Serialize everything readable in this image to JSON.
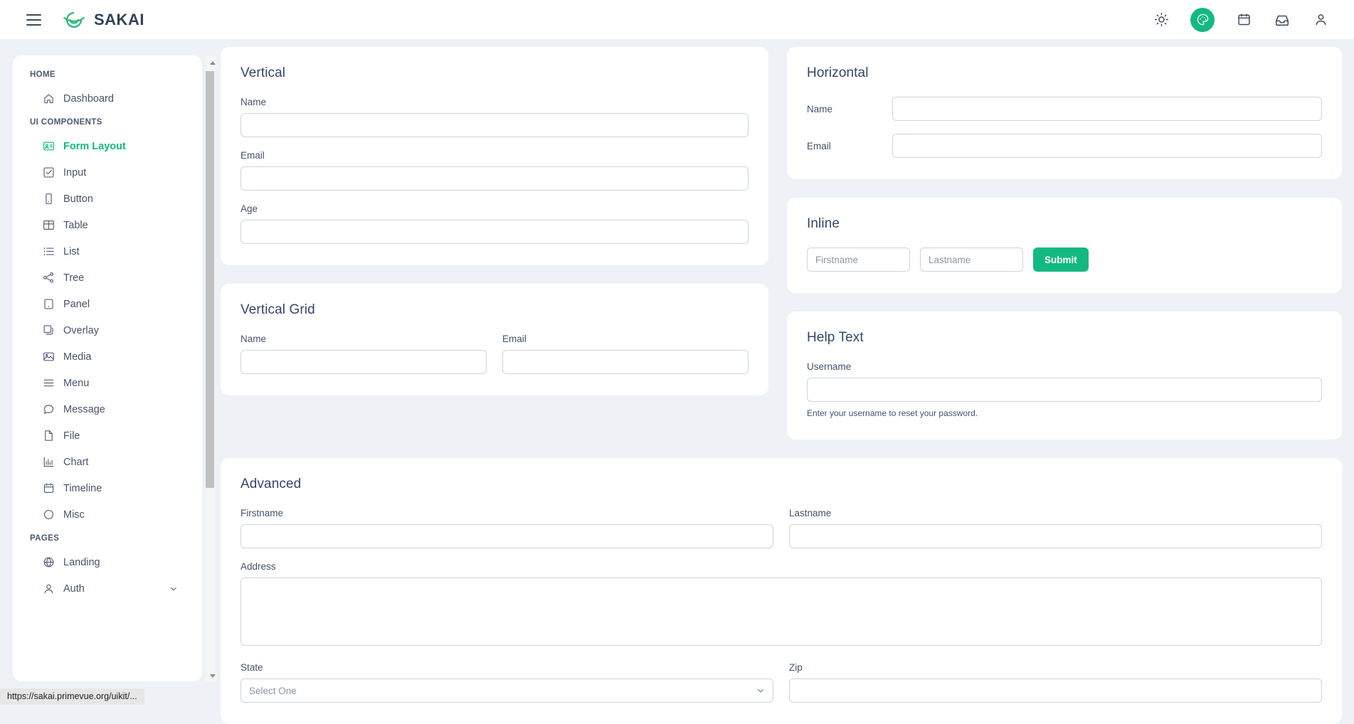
{
  "topbar": {
    "brand": "SAKAI",
    "menu_toggle": "menu-toggle",
    "icons": [
      {
        "name": "sun-icon",
        "label": "Light mode"
      },
      {
        "name": "palette-icon",
        "label": "Theme"
      },
      {
        "name": "calendar-icon",
        "label": "Calendar"
      },
      {
        "name": "inbox-icon",
        "label": "Inbox"
      },
      {
        "name": "user-icon",
        "label": "Profile"
      }
    ]
  },
  "sidebar": {
    "sections": [
      {
        "title": "HOME",
        "items": [
          {
            "label": "Dashboard",
            "icon": "home-icon",
            "active": false
          }
        ]
      },
      {
        "title": "UI COMPONENTS",
        "items": [
          {
            "label": "Form Layout",
            "icon": "id-card-icon",
            "active": true
          },
          {
            "label": "Input",
            "icon": "check-square-icon",
            "active": false
          },
          {
            "label": "Button",
            "icon": "mobile-icon",
            "active": false
          },
          {
            "label": "Table",
            "icon": "table-icon",
            "active": false
          },
          {
            "label": "List",
            "icon": "list-icon",
            "active": false
          },
          {
            "label": "Tree",
            "icon": "share-alt-icon",
            "active": false
          },
          {
            "label": "Panel",
            "icon": "tablet-icon",
            "active": false
          },
          {
            "label": "Overlay",
            "icon": "clone-icon",
            "active": false
          },
          {
            "label": "Media",
            "icon": "image-icon",
            "active": false
          },
          {
            "label": "Menu",
            "icon": "bars-icon",
            "active": false
          },
          {
            "label": "Message",
            "icon": "comment-icon",
            "active": false
          },
          {
            "label": "File",
            "icon": "file-icon",
            "active": false
          },
          {
            "label": "Chart",
            "icon": "chart-bar-icon",
            "active": false
          },
          {
            "label": "Timeline",
            "icon": "calendar-icon",
            "active": false
          },
          {
            "label": "Misc",
            "icon": "circle-icon",
            "active": false
          }
        ]
      },
      {
        "title": "PAGES",
        "items": [
          {
            "label": "Landing",
            "icon": "globe-icon",
            "active": false
          },
          {
            "label": "Auth",
            "icon": "user-icon",
            "active": false,
            "expandable": true
          }
        ]
      }
    ]
  },
  "cards": {
    "vertical": {
      "title": "Vertical",
      "fields": [
        {
          "label": "Name",
          "value": "",
          "placeholder": ""
        },
        {
          "label": "Email",
          "value": "",
          "placeholder": ""
        },
        {
          "label": "Age",
          "value": "",
          "placeholder": ""
        }
      ]
    },
    "vertical_grid": {
      "title": "Vertical Grid",
      "fields": [
        {
          "label": "Name",
          "value": "",
          "placeholder": ""
        },
        {
          "label": "Email",
          "value": "",
          "placeholder": ""
        }
      ]
    },
    "horizontal": {
      "title": "Horizontal",
      "fields": [
        {
          "label": "Name",
          "value": "",
          "placeholder": ""
        },
        {
          "label": "Email",
          "value": "",
          "placeholder": ""
        }
      ]
    },
    "inline": {
      "title": "Inline",
      "firstname_placeholder": "Firstname",
      "lastname_placeholder": "Lastname",
      "firstname_value": "",
      "lastname_value": "",
      "submit_label": "Submit"
    },
    "help_text": {
      "title": "Help Text",
      "username_label": "Username",
      "username_value": "",
      "note": "Enter your username to reset your password."
    },
    "advanced": {
      "title": "Advanced",
      "firstname_label": "Firstname",
      "firstname_value": "",
      "lastname_label": "Lastname",
      "lastname_value": "",
      "address_label": "Address",
      "address_value": "",
      "state_label": "State",
      "state_value": "Select One",
      "zip_label": "Zip",
      "zip_value": ""
    }
  },
  "statusbar": {
    "url": "https://sakai.primevue.org/uikit/..."
  },
  "colors": {
    "accent": "#13b981",
    "page_bg": "#eef2f6",
    "card_bg": "#ffffff",
    "text": "#344767",
    "border": "#ccd5de"
  }
}
